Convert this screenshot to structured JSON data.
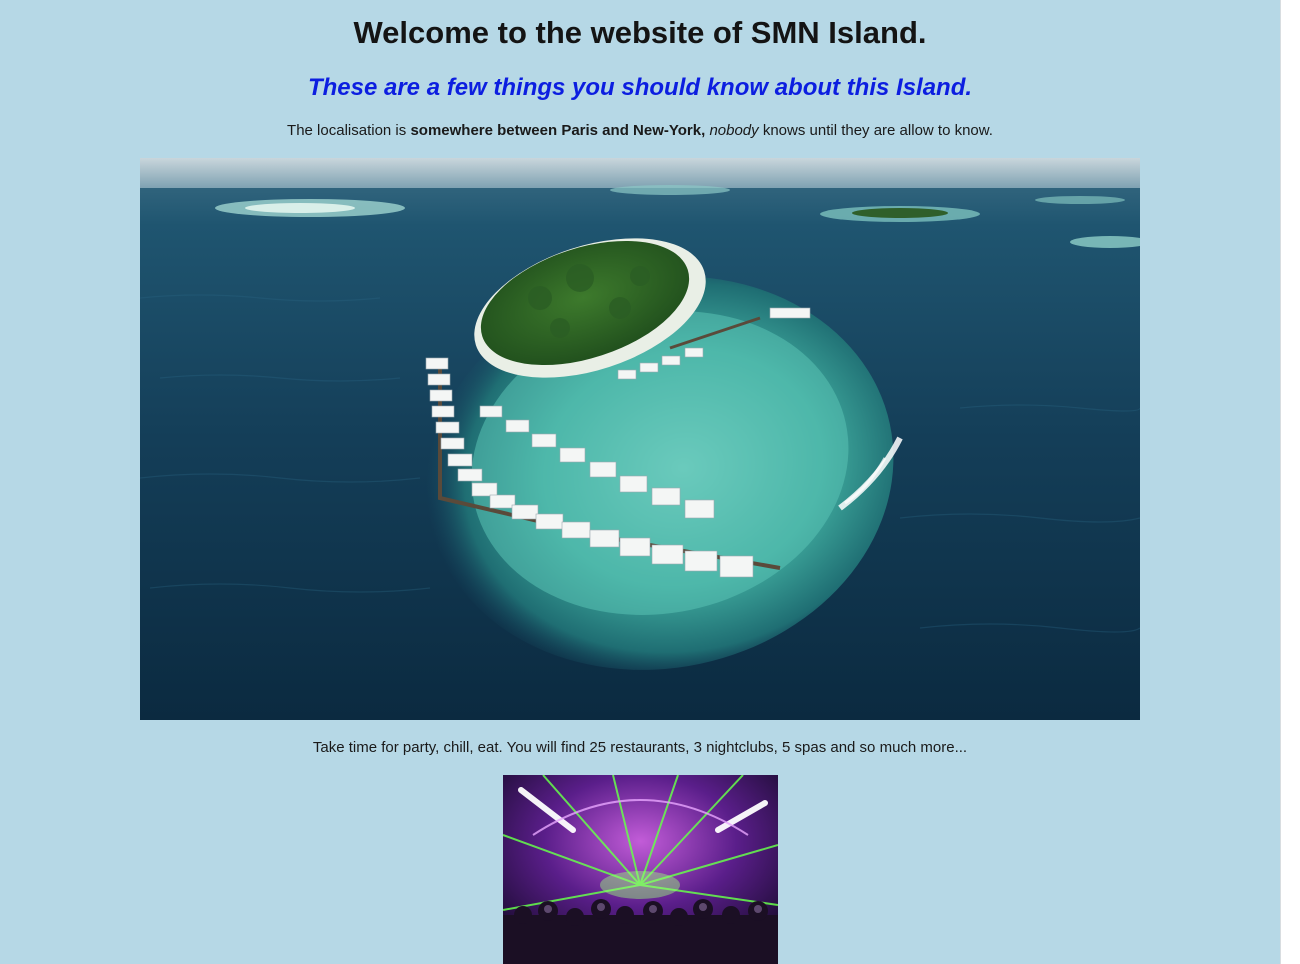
{
  "header": {
    "title": "Welcome to the website of SMN Island.",
    "subtitle": "These are a few things you should know about this Island."
  },
  "intro": {
    "prefix": "The localisation is ",
    "bold": "somewhere between Paris and New-York,",
    "space": " ",
    "italic": "nobody",
    "suffix": " knows until they are allow to know."
  },
  "party": {
    "text": "Take time for party, chill, eat. You will find 25 restaurants, 3 nightclubs, 5 spas and so much more..."
  },
  "images": {
    "island_photo": "island-aerial-photo",
    "club_photo": "nightclub-photo"
  },
  "colors": {
    "background": "#b6d8e6",
    "subtitle": "#0c1ee0"
  }
}
